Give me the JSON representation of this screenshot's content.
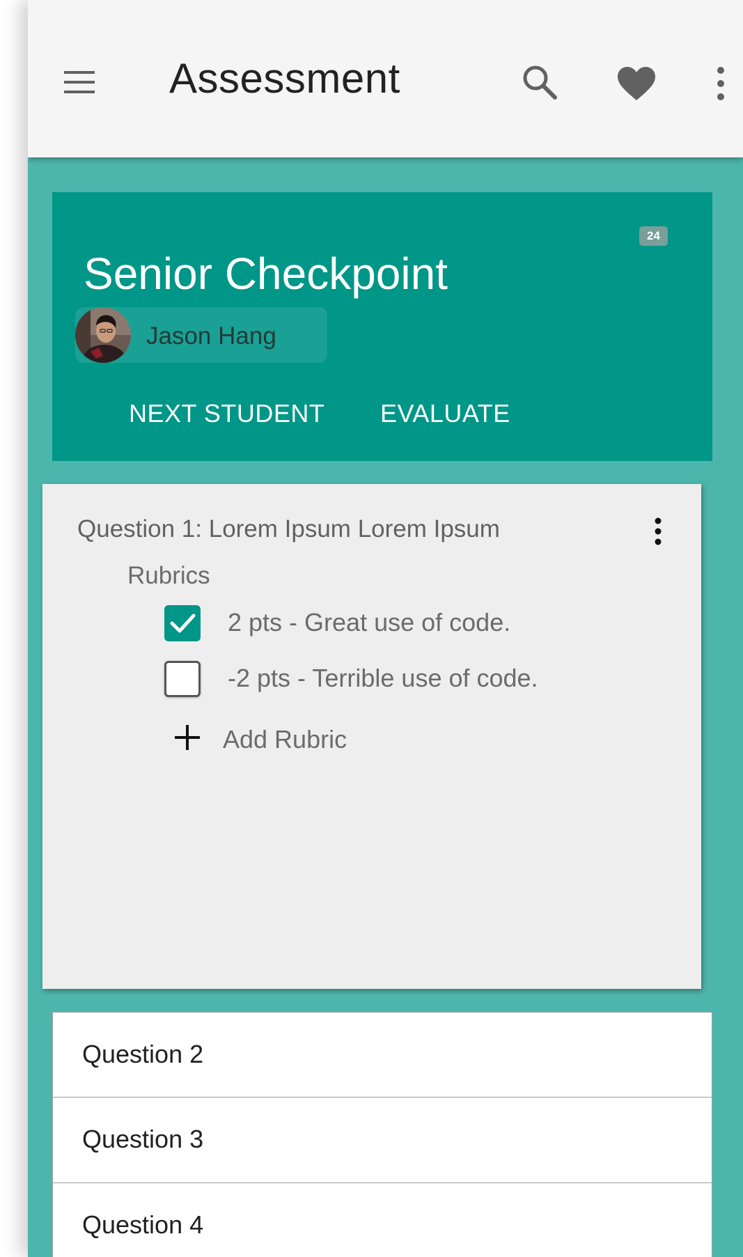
{
  "app_bar": {
    "title": "Assessment",
    "icons": [
      "menu-icon",
      "search-icon",
      "heart-icon",
      "more-vert-icon"
    ]
  },
  "header": {
    "badge_count": "24",
    "course_title": "Senior Checkpoint",
    "student": {
      "name": "Jason Hang",
      "avatar": "avatar-photo"
    },
    "buttons": {
      "next_student": "NEXT STUDENT",
      "evaluate": "EVALUATE"
    }
  },
  "question_card": {
    "title": "Question 1: Lorem Ipsum Lorem Ipsum",
    "rubrics_label": "Rubrics",
    "rubrics": [
      {
        "text": "2 pts - Great use of code.",
        "checked": true
      },
      {
        "text": "-2 pts - Terrible use of code.",
        "checked": false
      }
    ],
    "add_rubric_label": "Add Rubric"
  },
  "questions": [
    {
      "label": "Question 2"
    },
    {
      "label": "Question 3"
    },
    {
      "label": "Question 4"
    }
  ],
  "colors": {
    "primary": "#009688",
    "background": "#4db6ac",
    "app_bar": "#f5f5f5",
    "card": "#eeeeee"
  }
}
